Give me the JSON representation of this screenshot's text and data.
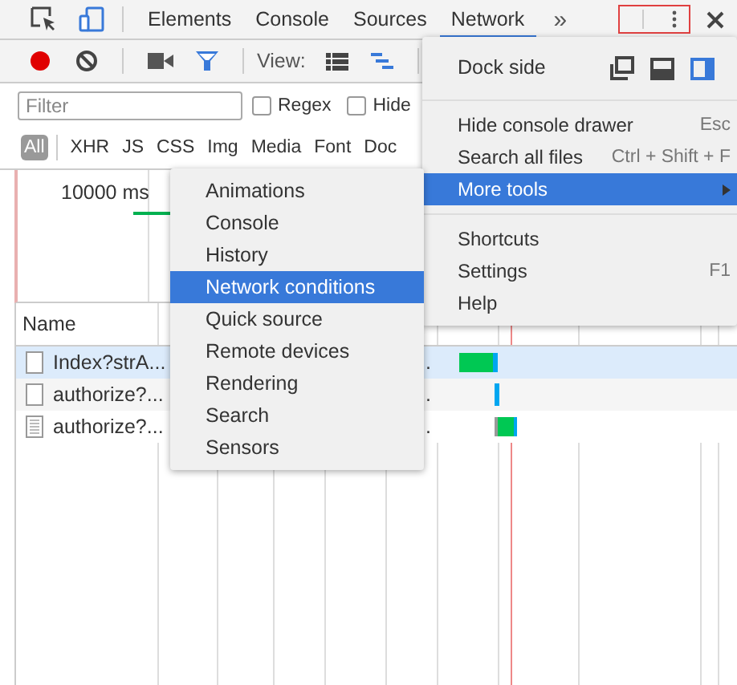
{
  "tabs": [
    {
      "label": "Elements",
      "selected": false
    },
    {
      "label": "Console",
      "selected": false
    },
    {
      "label": "Sources",
      "selected": false
    },
    {
      "label": "Network",
      "selected": true
    }
  ],
  "overflow": "»",
  "toolbar": {
    "recording": true,
    "filter_shown": true,
    "view_label": "View:",
    "large_rows": false
  },
  "filter": {
    "placeholder": "Filter",
    "options": [
      {
        "label": "Regex",
        "checked": false
      },
      {
        "label": "Hide",
        "checked": false
      }
    ]
  },
  "type_filters": [
    {
      "label": "All",
      "selected": true
    },
    {
      "label": "XHR",
      "selected": false
    },
    {
      "label": "JS",
      "selected": false
    },
    {
      "label": "CSS",
      "selected": false
    },
    {
      "label": "Img",
      "selected": false
    },
    {
      "label": "Media",
      "selected": false
    },
    {
      "label": "Font",
      "selected": false
    },
    {
      "label": "Doc",
      "selected": false
    }
  ],
  "overview": {
    "tick": "10000 ms"
  },
  "table": {
    "columns": [
      "Name"
    ],
    "rows": [
      {
        "name": "Index?strA...",
        "column_2": ".",
        "kind": "blank",
        "selected": true
      },
      {
        "name": "authorize?...",
        "column_2": ".",
        "kind": "blank",
        "selected": false
      },
      {
        "name": "authorize?...",
        "column_2": ".",
        "kind": "text",
        "selected": false
      }
    ]
  },
  "main_menu": {
    "dock_label": "Dock side",
    "dock_options": [
      {
        "kind": "undock",
        "selected": false
      },
      {
        "kind": "bottom",
        "selected": false
      },
      {
        "kind": "right",
        "selected": true
      }
    ],
    "groups": [
      [
        {
          "label": "Hide console drawer",
          "shortcut": "Esc",
          "selected": false,
          "submenu": false
        },
        {
          "label": "Search all files",
          "shortcut": "Ctrl + Shift + F",
          "selected": false,
          "submenu": false
        },
        {
          "label": "More tools",
          "selected": true,
          "submenu": true
        }
      ],
      [
        {
          "label": "Shortcuts",
          "selected": false,
          "submenu": false
        },
        {
          "label": "Settings",
          "shortcut": "F1",
          "selected": false,
          "submenu": false
        },
        {
          "label": "Help",
          "selected": false,
          "submenu": false
        }
      ]
    ]
  },
  "submenu": {
    "items": [
      {
        "label": "Animations",
        "selected": false
      },
      {
        "label": "Console",
        "selected": false
      },
      {
        "label": "History",
        "selected": false
      },
      {
        "label": "Network conditions",
        "selected": true
      },
      {
        "label": "Quick source",
        "selected": false
      },
      {
        "label": "Remote devices",
        "selected": false
      },
      {
        "label": "Rendering",
        "selected": false
      },
      {
        "label": "Search",
        "selected": false
      },
      {
        "label": "Sensors",
        "selected": false
      }
    ]
  }
}
